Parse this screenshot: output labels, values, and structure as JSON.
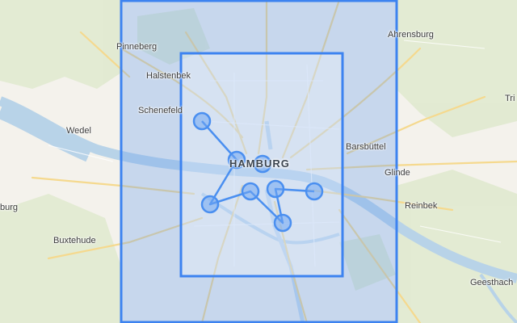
{
  "map": {
    "city_label": "HAMBURG",
    "place_labels": {
      "pinneberg": "Pinneberg",
      "ahrensburg": "Ahrensburg",
      "halstenbek": "Halstenbek",
      "schenefeld": "Schenefeld",
      "wedel": "Wedel",
      "barsbuttel": "Barsbüttel",
      "glinde": "Glinde",
      "reinbek": "Reinbek",
      "buxtehude": "Buxtehude",
      "geesthacht": "Geesthach",
      "edge_left": "burg",
      "edge_right": "Tri"
    },
    "colors": {
      "base": "#f4f2ec",
      "green": "#dfe9c6",
      "water": "#b8d3e8",
      "roads": "#f7d98a",
      "outer_box_fill": "#6a9ff0",
      "outer_box_stroke": "#3d83f0",
      "marker": "#4a8ff0"
    }
  }
}
